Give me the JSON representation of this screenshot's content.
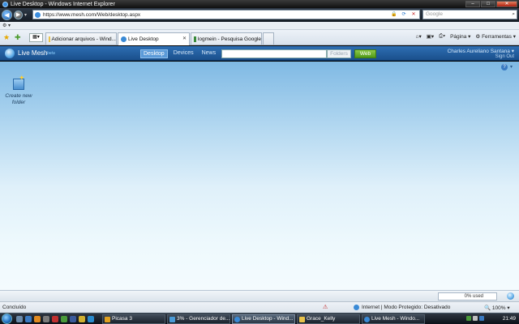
{
  "window": {
    "title": "Live Desktop - Windows Internet Explorer"
  },
  "addressbar": {
    "url": "https://www.mesh.com/Web/desktop.aspx",
    "search_placeholder": "Google"
  },
  "tabs": [
    {
      "label": "Adicionar arquivos - Wind..."
    },
    {
      "label": "Live Desktop"
    },
    {
      "label": "logmein - Pesquisa Google"
    }
  ],
  "toolbar": {
    "page_label": "Página",
    "tools_label": "Ferramentas"
  },
  "mesh": {
    "brand": "Live Mesh",
    "beta": "beta",
    "nav": [
      "Desktop",
      "Devices",
      "News"
    ],
    "folders_label": "Folders",
    "web_label": "Web",
    "user_name": "Charles Aureliano Santana",
    "sign_out": "Sign Out"
  },
  "desktop": {
    "item_label": "Create new folder"
  },
  "mesh_status": {
    "usage": "0% used"
  },
  "ie_status": {
    "done": "Concluído",
    "zone": "Internet | Modo Protegido: Desativado",
    "zoom": "100%"
  },
  "taskbar": {
    "buttons": [
      "Picasa 3",
      "3% - Gerenciador de...",
      "Live Desktop - Wind...",
      "Grace_Kelly",
      "Live Mesh - Windo..."
    ],
    "clock": "21:49"
  },
  "colors": {
    "mesh_header": "#1f5a9c",
    "web_button": "#5fa82a",
    "desktop_top": "#7fb9e4"
  }
}
